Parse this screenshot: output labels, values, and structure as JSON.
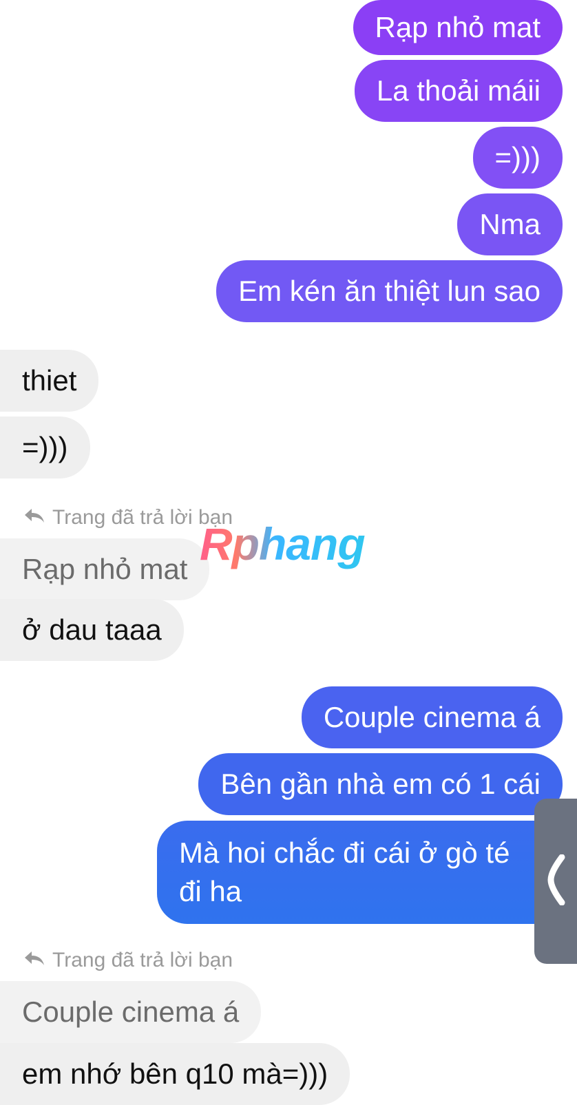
{
  "messages": {
    "out1": "Rạp nhỏ mat",
    "out2": "La thoải máii",
    "out3": "=)))",
    "out4": "Nma",
    "out5": "Em kén ăn thiệt lun sao",
    "in1": "thiet",
    "in2": "=)))",
    "reply1_hint": "Trang đã trả lời bạn",
    "reply1_quote": "Rạp nhỏ mat",
    "in3": "ở dau taaa",
    "out6": "Couple cinema á",
    "out7": "Bên gần nhà em có 1 cái",
    "out8_line1": "Mà hoi chắc đi cái ở gò té",
    "out8_line2": "đi ha",
    "reply2_hint": "Trang đã trả lời bạn",
    "reply2_quote": "Couple cinema á",
    "in4": "em nhớ bên q10 mà=)))"
  },
  "watermark": "Rphang",
  "icons": {
    "reply": "reply-arrow-icon",
    "side_handle": "chevron-left-icon"
  },
  "colors": {
    "outgoing_purple": "#8b3ff5",
    "outgoing_blue": "#3a6cee",
    "incoming_bg": "#efefef"
  }
}
